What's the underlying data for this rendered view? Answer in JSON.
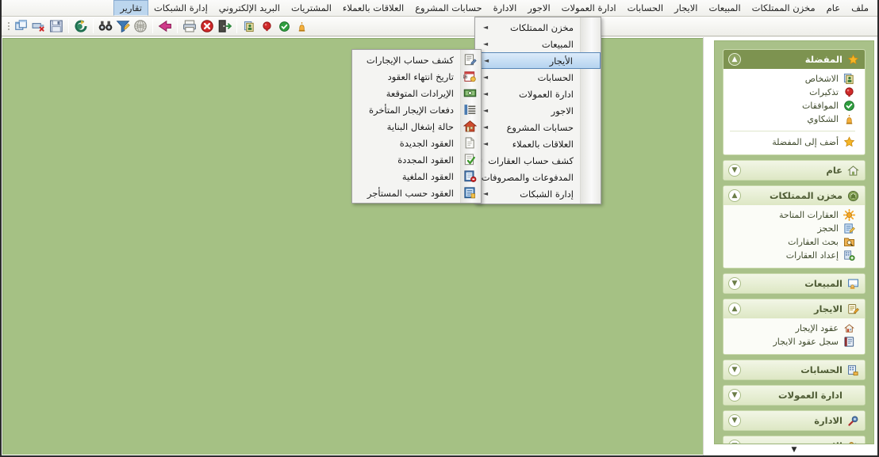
{
  "menubar": {
    "items": [
      {
        "label": "ملف",
        "name": "menu-file"
      },
      {
        "label": "عام",
        "name": "menu-general"
      },
      {
        "label": "مخزن الممتلكات",
        "name": "menu-property-store"
      },
      {
        "label": "المبيعات",
        "name": "menu-sales"
      },
      {
        "label": "الايجار",
        "name": "menu-rent"
      },
      {
        "label": "الحسابات",
        "name": "menu-accounts"
      },
      {
        "label": "ادارة العمولات",
        "name": "menu-commissions"
      },
      {
        "label": "الاجور",
        "name": "menu-wages"
      },
      {
        "label": "الادارة",
        "name": "menu-administration"
      },
      {
        "label": "حسابات المشروع",
        "name": "menu-project-accounts"
      },
      {
        "label": "العلاقات بالعملاء",
        "name": "menu-customer-relations"
      },
      {
        "label": "المشتريات",
        "name": "menu-purchases"
      },
      {
        "label": "البريد الإلكتروني",
        "name": "menu-email"
      },
      {
        "label": "إدارة الشبكات",
        "name": "menu-network-admin"
      },
      {
        "label": "تقارير",
        "name": "menu-reports",
        "active": true
      }
    ]
  },
  "toolbar": {
    "buttons": [
      {
        "name": "new-window-icon",
        "title": "نافذة جديدة"
      },
      {
        "name": "delete-record-icon",
        "title": "حذف"
      },
      {
        "name": "save-icon",
        "title": "حفظ"
      },
      {
        "name": "refresh-icon",
        "title": "تحديث"
      },
      {
        "name": "binoculars-search-icon",
        "title": "بحث"
      },
      {
        "name": "filter-icon",
        "title": "تصفية"
      },
      {
        "name": "globe-icon",
        "title": "عام"
      },
      {
        "name": "back-arrow-icon",
        "title": "رجوع"
      },
      {
        "name": "print-icon",
        "title": "طباعة"
      },
      {
        "name": "cancel-icon",
        "title": "إلغاء"
      },
      {
        "name": "exit-icon",
        "title": "خروج"
      },
      {
        "name": "persons-icon",
        "title": "الأشخاص"
      },
      {
        "name": "reminder-icon",
        "title": "تذكيرات"
      },
      {
        "name": "approve-icon",
        "title": "الموافقات"
      },
      {
        "name": "complaints-icon",
        "title": "الشكاوي"
      }
    ]
  },
  "sidebar": {
    "panels": [
      {
        "title": "المفضلة",
        "name": "panel-favorites",
        "icon": "star-icon",
        "highlighted": true,
        "expanded": true,
        "chevron": "collapse",
        "items": [
          {
            "label": "الاشخاص",
            "icon": "persons-icon",
            "name": "nav-persons"
          },
          {
            "label": "تذكيرات",
            "icon": "reminder-icon",
            "name": "nav-reminders"
          },
          {
            "label": "الموافقات",
            "icon": "approve-icon",
            "name": "nav-approvals"
          },
          {
            "label": "الشكاوي",
            "icon": "complaints-icon",
            "name": "nav-complaints"
          }
        ],
        "footer": {
          "label": "أضف إلى المفضلة",
          "icon": "star-icon",
          "name": "nav-add-favorite"
        }
      },
      {
        "title": "عام",
        "name": "panel-general",
        "icon": "home-icon",
        "highlighted": false,
        "expanded": false,
        "chevron": "expand",
        "items": []
      },
      {
        "title": "مخزن الممتلكات",
        "name": "panel-property-store",
        "icon": "warehouse-icon",
        "highlighted": false,
        "expanded": true,
        "chevron": "collapse",
        "items": [
          {
            "label": "العقارات المتاحة",
            "icon": "available-properties-icon",
            "name": "nav-available-properties"
          },
          {
            "label": "الحجز",
            "icon": "booking-icon",
            "name": "nav-booking"
          },
          {
            "label": "بحث العقارات",
            "icon": "property-search-icon",
            "name": "nav-property-search"
          },
          {
            "label": "إعداد العقارات",
            "icon": "property-setup-icon",
            "name": "nav-property-setup"
          }
        ]
      },
      {
        "title": "المبيعات",
        "name": "panel-sales",
        "icon": "sales-icon",
        "highlighted": false,
        "expanded": false,
        "chevron": "expand",
        "items": []
      },
      {
        "title": "الايجار",
        "name": "panel-rent",
        "icon": "rent-icon",
        "highlighted": false,
        "expanded": true,
        "chevron": "collapse",
        "items": [
          {
            "label": "عقود الإيجار",
            "icon": "rent-contract-icon",
            "name": "nav-rent-contracts"
          },
          {
            "label": "سجل عقود الايجار",
            "icon": "rent-log-icon",
            "name": "nav-rent-contracts-log"
          }
        ]
      },
      {
        "title": "الحسابات",
        "name": "panel-accounts",
        "icon": "accounts-icon",
        "highlighted": false,
        "expanded": false,
        "chevron": "expand",
        "items": []
      },
      {
        "title": "ادارة العمولات",
        "name": "panel-commissions",
        "icon": "",
        "highlighted": false,
        "expanded": false,
        "chevron": "expand",
        "items": []
      },
      {
        "title": "الادارة",
        "name": "panel-administration",
        "icon": "admin-icon",
        "highlighted": false,
        "expanded": false,
        "chevron": "expand",
        "items": []
      },
      {
        "title": "الاجور",
        "name": "panel-wages",
        "icon": "wages-icon",
        "highlighted": false,
        "expanded": false,
        "chevron": "expand",
        "items": []
      }
    ],
    "scroll_down": "▼"
  },
  "reports_menu": {
    "items": [
      {
        "label": "مخزن الممتلكات",
        "name": "reports-property-store",
        "arrow": "►",
        "selected": false
      },
      {
        "label": "المبيعات",
        "name": "reports-sales",
        "arrow": "►",
        "selected": false
      },
      {
        "label": "الأيجار",
        "name": "reports-rent",
        "arrow": "►",
        "selected": true
      },
      {
        "label": "الحسابات",
        "name": "reports-accounts",
        "arrow": "►",
        "selected": false
      },
      {
        "label": "ادارة العمولات",
        "name": "reports-commissions",
        "arrow": "►",
        "selected": false
      },
      {
        "label": "الاجور",
        "name": "reports-wages",
        "arrow": "►",
        "selected": false
      },
      {
        "label": "حسابات المشروع",
        "name": "reports-project-accounts",
        "arrow": "►",
        "selected": false
      },
      {
        "label": "العلاقات بالعملاء",
        "name": "reports-customer-relations",
        "arrow": "►",
        "selected": false
      },
      {
        "label": "كشف حساب العقارات",
        "name": "reports-property-statement",
        "arrow": "►",
        "selected": false
      },
      {
        "label": "المدفوعات والمصروفات",
        "name": "reports-payments-expenses",
        "arrow": "►",
        "selected": false
      },
      {
        "label": "إدارة الشبكات",
        "name": "reports-network-admin",
        "arrow": "►",
        "selected": false
      }
    ]
  },
  "rent_submenu": {
    "items": [
      {
        "label": "كشف حساب الإيجارات",
        "icon": "statement-icon",
        "name": "rent-statement"
      },
      {
        "label": "تاريخ انتهاء العقود",
        "icon": "calendar-icon",
        "name": "rent-contract-expiry"
      },
      {
        "label": "الإيرادات المتوقعة",
        "icon": "money-icon",
        "name": "rent-expected-revenue"
      },
      {
        "label": "دفعات الإيجار المتأخرة",
        "icon": "list-icon",
        "name": "rent-late-payments"
      },
      {
        "label": "حالة إشغال البناية",
        "icon": "building-icon",
        "name": "rent-occupancy-status"
      },
      {
        "label": "العقود الجديدة",
        "icon": "document-icon",
        "name": "rent-new-contracts"
      },
      {
        "label": "العقود المجددة",
        "icon": "renew-icon",
        "name": "rent-renewed-contracts"
      },
      {
        "label": "العقود الملغية",
        "icon": "cancelled-icon",
        "name": "rent-cancelled-contracts"
      },
      {
        "label": "العقود حسب المستأجر",
        "icon": "tenant-icon",
        "name": "rent-contracts-by-tenant"
      }
    ]
  },
  "colors": {
    "canvas": "#a5c184",
    "sidebar_bg": "#a9c189",
    "panel_header_highlight": "#7d9350",
    "menu_selected": "#b5d3ef",
    "menubar_active": "#bcd6ee"
  }
}
